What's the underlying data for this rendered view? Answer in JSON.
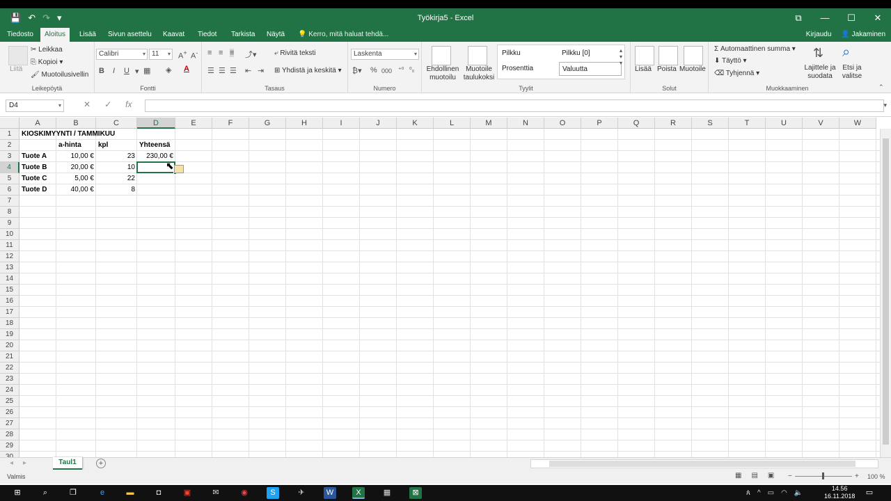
{
  "title_bar": {
    "title": "Työkirja5 - Excel",
    "qat_save": "💾",
    "qat_undo": "↶",
    "qat_redo": "↷",
    "qat_more": "▾",
    "restore": "⧉",
    "minimize": "—",
    "maximize": "☐",
    "close": "✕"
  },
  "tabs": [
    "Tiedosto",
    "Aloitus",
    "Lisää",
    "Sivun asettelu",
    "Kaavat",
    "Tiedot",
    "Tarkista",
    "Näytä"
  ],
  "active_tab": "Aloitus",
  "tell_me": "Kerro, mitä haluat tehdä...",
  "signin": "Kirjaudu",
  "share": "Jakaminen",
  "ribbon": {
    "clipboard": {
      "label": "Leikepöytä",
      "paste": "Liitä",
      "cut": "Leikkaa",
      "copy": "Kopioi",
      "format_painter": "Muotoilusivellin"
    },
    "font": {
      "label": "Fontti",
      "name": "Calibri",
      "size": "11",
      "bold": "B",
      "italic": "I",
      "underline": "U"
    },
    "alignment": {
      "label": "Tasaus",
      "wrap": "Rivitä teksti",
      "merge": "Yhdistä ja keskitä"
    },
    "number": {
      "label": "Numero",
      "format": "Laskenta",
      "percent": "%",
      "thousands": "000"
    },
    "styles": {
      "label": "Tyylit",
      "conditional": "Ehdollinen muotoilu",
      "format_table": "Muotoile taulukoksi",
      "comma": "Pilkku",
      "comma0": "Pilkku [0]",
      "percent": "Prosenttia",
      "currency": "Valuutta"
    },
    "cells": {
      "label": "Solut",
      "insert": "Lisää",
      "delete": "Poista",
      "format": "Muotoile"
    },
    "editing": {
      "label": "Muokkaaminen",
      "autosum": "Automaattinen summa",
      "fill": "Täyttö",
      "clear": "Tyhjennä",
      "sort": "Lajittele ja suodata",
      "find": "Etsi ja valitse"
    }
  },
  "formula_bar": {
    "name_box": "D4",
    "cancel": "✕",
    "enter": "✓",
    "fx": "fx",
    "value": ""
  },
  "columns": [
    "A",
    "B",
    "C",
    "D",
    "E",
    "F",
    "G",
    "H",
    "I",
    "J",
    "K",
    "L",
    "M",
    "N",
    "O",
    "P",
    "Q",
    "R",
    "S",
    "T",
    "U",
    "V",
    "W"
  ],
  "rows": 30,
  "cells": {
    "A1": "KIOSKIMYYNTI / TAMMIKUU",
    "B2": "a-hinta",
    "C2": "kpl",
    "D2": "Yhteensä",
    "A3": "Tuote A",
    "B3": "10,00 €",
    "C3": "23",
    "D3": "230,00 €",
    "A4": "Tuote B",
    "B4": "20,00 €",
    "C4": "10",
    "A5": "Tuote C",
    "B5": "5,00 €",
    "C5": "22",
    "A6": "Tuote D",
    "B6": "40,00 €",
    "C6": "8"
  },
  "active_cell": "D4",
  "sheet_tab": "Taul1",
  "add_sheet": "+",
  "status": {
    "ready": "Valmis",
    "zoom": "100 %"
  },
  "taskbar": {
    "time": "14.56",
    "date": "16.11.2018"
  },
  "colors": {
    "excel_green": "#217346"
  }
}
